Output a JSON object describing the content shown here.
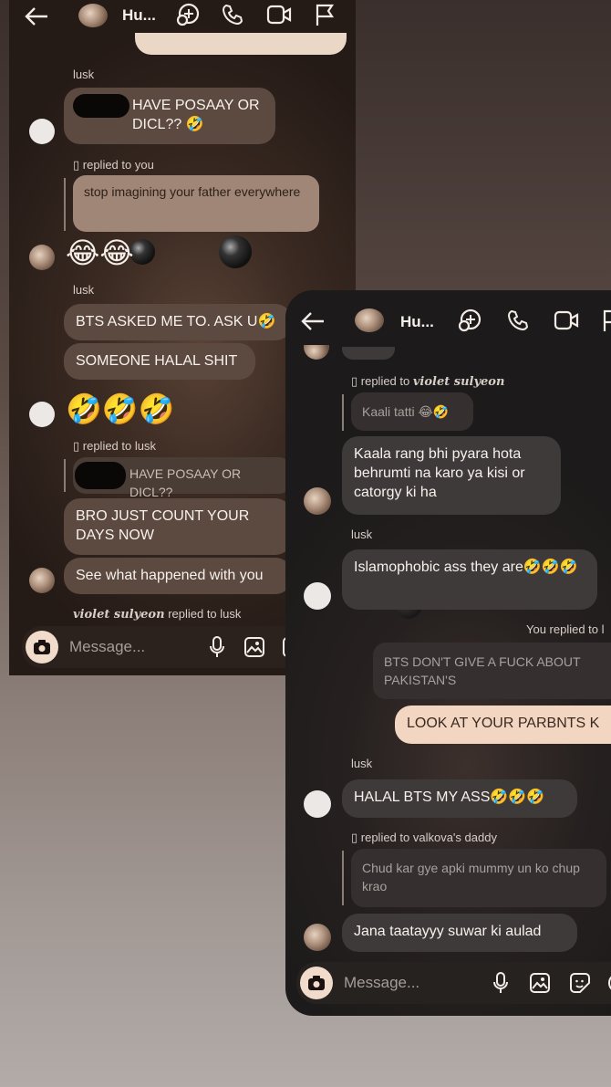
{
  "colors": {
    "accent_peach": "#f3d6c2",
    "bubble_brown": "#5c4a40",
    "bubble_dark": "#3e3a3a"
  },
  "shot1": {
    "header": {
      "title": "Hu...",
      "icons": [
        "back-arrow-icon",
        "group-avatar-icon",
        "effects-icon",
        "phone-icon",
        "video-icon",
        "flag-icon"
      ]
    },
    "sender_lusk_1": "lusk",
    "msg_posaay": "HAVE POSAAY OR DICL?? 🤣",
    "reply_note_1": "replied to you",
    "quote_father": "stop imagining your father everywhere",
    "emoji_laugh": "😂😂",
    "sender_lusk_2": "lusk",
    "msg_bts_asked": "BTS ASKED ME TO. ASK U🤣",
    "msg_someone_halal": "SOMEONE HALAL SHIT",
    "emoji_rofl": "🤣🤣🤣",
    "reply_note_2": "replied to lusk",
    "quote_posaay": "HAVE POSAAY OR DICL??",
    "msg_count_days": "BRO JUST COUNT YOUR DAYS NOW",
    "msg_see_what": "See what happened with you",
    "reply_note_3_name": "violet sulyeon",
    "reply_note_3_rest": "replied to lusk",
    "composer_placeholder": "Message..."
  },
  "shot2": {
    "header": {
      "title": "Hu...",
      "icons": [
        "back-arrow-icon",
        "group-avatar-icon",
        "effects-icon",
        "phone-icon",
        "video-icon",
        "flag-icon"
      ]
    },
    "reply_note_1_prefix": "replied to",
    "reply_note_1_name": "violet sulyeon",
    "quote_kaali": "Kaali tatti 😂🤣",
    "msg_kaala": "Kaala rang bhi pyara hota behrumti na karo ya kisi or catorgy ki ha",
    "sender_lusk_1": "lusk",
    "msg_islamophobic": "Islamophobic ass they are🤣🤣🤣",
    "you_replied": "You replied to l",
    "quote_bts_dont": "BTS DON'T GIVE A FUCK ABOUT PAKISTAN'S",
    "msg_look_parents": "LOOK AT YOUR PARBNTS K",
    "sender_lusk_2": "lusk",
    "msg_halal_bts": "HALAL BTS MY ASS🤣🤣🤣",
    "reply_note_2": "replied to valkova's daddy",
    "quote_chud": "Chud kar gye apki mummy un ko chup krao",
    "msg_jana": "Jana taatayyy suwar ki aulad",
    "composer_placeholder": "Message..."
  }
}
